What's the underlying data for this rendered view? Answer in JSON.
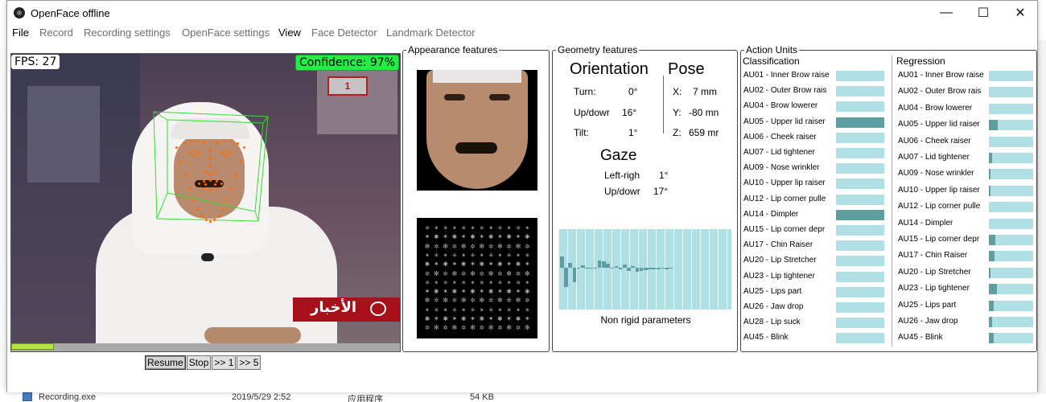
{
  "window": {
    "title": "OpenFace offline",
    "controls": {
      "minimize": "—",
      "maximize": "☐",
      "close": "✕"
    }
  },
  "menu": [
    {
      "label": "File",
      "enabled": true
    },
    {
      "label": "Record",
      "enabled": false
    },
    {
      "label": "Recording settings",
      "enabled": false
    },
    {
      "label": "OpenFace settings",
      "enabled": false
    },
    {
      "label": "View",
      "enabled": true
    },
    {
      "label": "Face Detector",
      "enabled": false
    },
    {
      "label": "Landmark Detector",
      "enabled": false
    }
  ],
  "video": {
    "fps_text": "FPS: 27",
    "confidence_text": "Confidence: 97%",
    "progress_fraction": 0.11,
    "banner_text": "الأخبار"
  },
  "playback_buttons": [
    {
      "label": "Resume",
      "pressed": true
    },
    {
      "label": "Stop",
      "pressed": false
    },
    {
      "label": ">> 1",
      "pressed": false
    },
    {
      "label": ">> 5",
      "pressed": false
    }
  ],
  "appearance": {
    "title": "Appearance features"
  },
  "geometry": {
    "title": "Geometry features",
    "orientation": {
      "heading": "Orientation",
      "rows": [
        {
          "label": "Turn:",
          "value": "0°"
        },
        {
          "label": "Up/dowr",
          "value": "16°"
        },
        {
          "label": "Tilt:",
          "value": "1°"
        }
      ]
    },
    "pose": {
      "heading": "Pose",
      "rows": [
        {
          "label": "X:",
          "value": "7 mm"
        },
        {
          "label": "Y:",
          "value": "-80 mn"
        },
        {
          "label": "Z:",
          "value": "659 mr"
        }
      ]
    },
    "gaze": {
      "heading": "Gaze",
      "rows": [
        {
          "label": "Left-righ",
          "value": "1°"
        },
        {
          "label": "Up/dowr",
          "value": "17°"
        }
      ]
    },
    "nonrigid_label": "Non rigid parameters",
    "nonrigid_values": [
      0.35,
      -0.6,
      0.15,
      -0.45,
      0.0,
      0.08,
      0.0,
      0.0,
      0.0,
      0.22,
      0.2,
      0.12,
      0.0,
      0.05,
      -0.05,
      0.1,
      -0.1,
      0.05,
      -0.12,
      -0.1,
      -0.08,
      -0.05,
      -0.06,
      -0.05,
      -0.02,
      -0.04,
      -0.03
    ]
  },
  "action_units": {
    "title": "Action Units",
    "classification": {
      "title": "Classification",
      "rows": [
        {
          "name": "AU01 - Inner Brow raise",
          "value": 0
        },
        {
          "name": "AU02 - Outer Brow rais",
          "value": 0
        },
        {
          "name": "AU04 - Brow lowerer",
          "value": 0
        },
        {
          "name": "AU05 - Upper lid raiser",
          "value": 1
        },
        {
          "name": "AU06 - Cheek raiser",
          "value": 0
        },
        {
          "name": "AU07 - Lid tightener",
          "value": 0
        },
        {
          "name": "AU09 - Nose wrinkler",
          "value": 0
        },
        {
          "name": "AU10 - Upper lip raiser",
          "value": 0
        },
        {
          "name": "AU12 - Lip corner pulle",
          "value": 0
        },
        {
          "name": "AU14 - Dimpler",
          "value": 1
        },
        {
          "name": "AU15 - Lip corner depr",
          "value": 0
        },
        {
          "name": "AU17 - Chin Raiser",
          "value": 0
        },
        {
          "name": "AU20 - Lip Stretcher",
          "value": 0
        },
        {
          "name": "AU23 - Lip tightener",
          "value": 0
        },
        {
          "name": "AU25 - Lips part",
          "value": 0
        },
        {
          "name": "AU26 - Jaw drop",
          "value": 0
        },
        {
          "name": "AU28 - Lip suck",
          "value": 0
        },
        {
          "name": "AU45 - Blink",
          "value": 0
        }
      ]
    },
    "regression": {
      "title": "Regression",
      "rows": [
        {
          "name": "AU01 - Inner Brow raise",
          "value": 0
        },
        {
          "name": "AU02 - Outer Brow rais",
          "value": 0
        },
        {
          "name": "AU04 - Brow lowerer",
          "value": 0
        },
        {
          "name": "AU05 - Upper lid raiser",
          "value": 0.2
        },
        {
          "name": "AU06 - Cheek raiser",
          "value": 0
        },
        {
          "name": "AU07 - Lid tightener",
          "value": 0.08
        },
        {
          "name": "AU09 - Nose wrinkler",
          "value": 0.03
        },
        {
          "name": "AU10 - Upper lip raiser",
          "value": 0.03
        },
        {
          "name": "AU12 - Lip corner pulle",
          "value": 0
        },
        {
          "name": "AU14 - Dimpler",
          "value": 0
        },
        {
          "name": "AU15 - Lip corner depr",
          "value": 0.14
        },
        {
          "name": "AU17 - Chin Raiser",
          "value": 0.12
        },
        {
          "name": "AU20 - Lip Stretcher",
          "value": 0.03
        },
        {
          "name": "AU23 - Lip tightener",
          "value": 0.18
        },
        {
          "name": "AU25 - Lips part",
          "value": 0.1
        },
        {
          "name": "AU26 - Jaw drop",
          "value": 0.08
        },
        {
          "name": "AU45 - Blink",
          "value": 0.1
        }
      ]
    },
    "colors": {
      "bar_bg": "#b0e0e6",
      "bar_fill": "#5f9ea0"
    }
  },
  "background_window": {
    "file_row": {
      "name": "Recording.exe",
      "date": "2019/5/29 2:52",
      "type": "应用程序",
      "size": "54 KB"
    }
  }
}
